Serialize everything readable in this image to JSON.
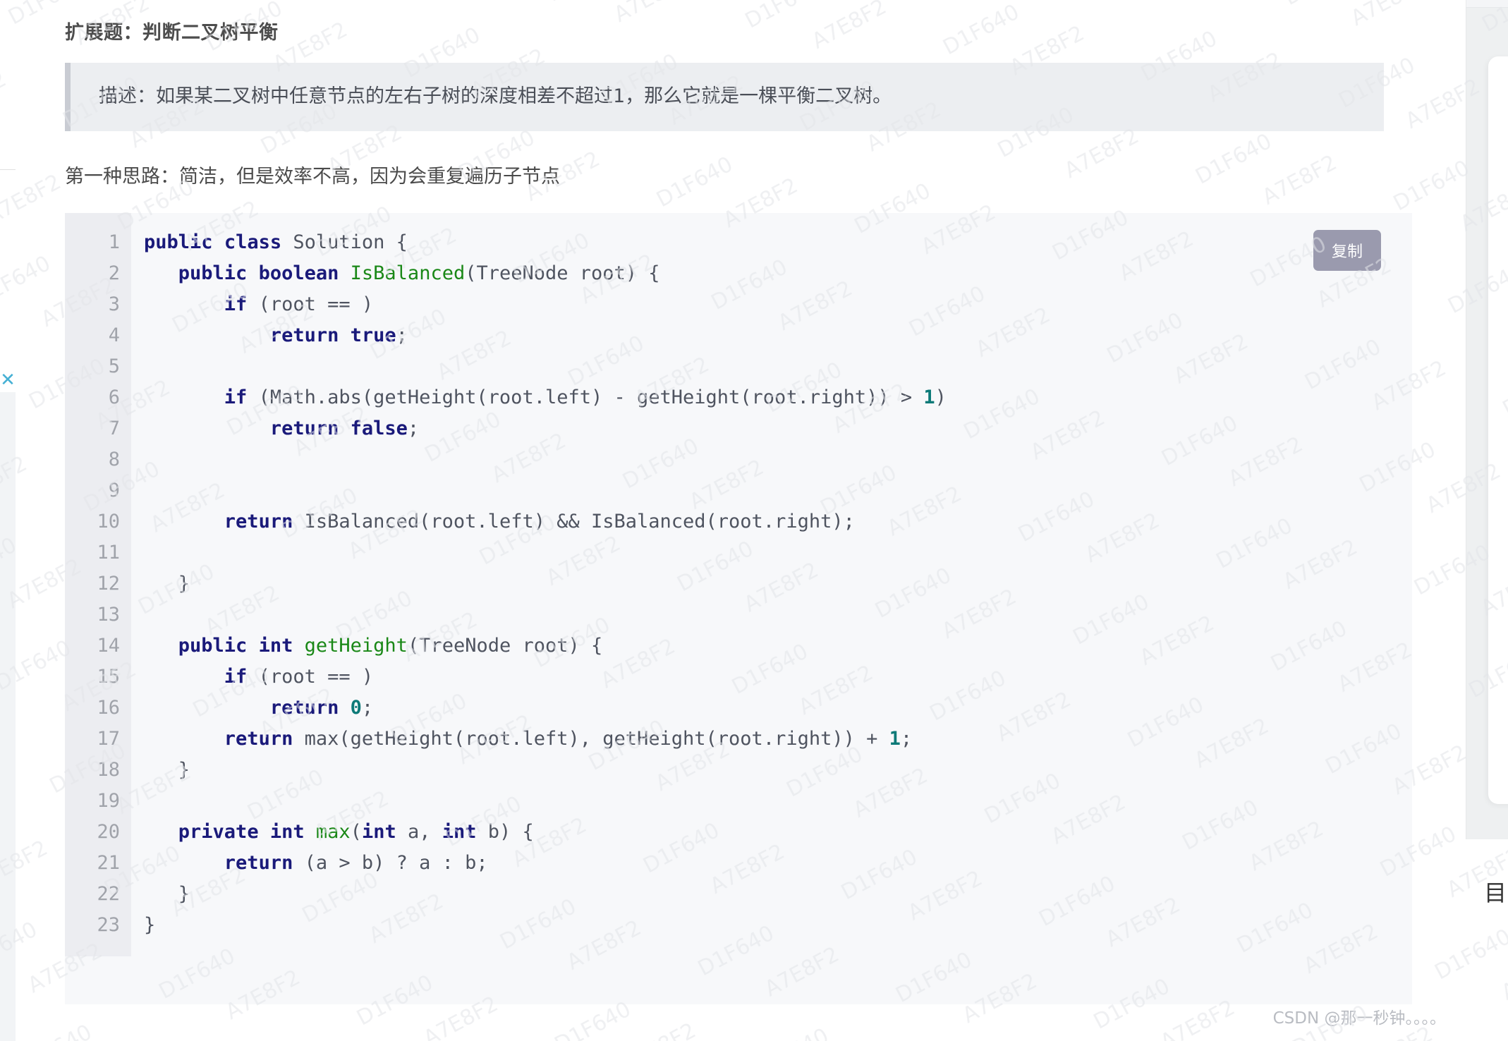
{
  "page": {
    "section_title": "扩展题：判断二叉树平衡",
    "quote_text": "描述：如果某二叉树中任意节点的左右子树的深度相差不超过1，那么它就是一棵平衡二叉树。",
    "approach_text": "第一种思路：简洁，但是效率不高，因为会重复遍历子节点",
    "watermark": "CSDN @那一秒钟。。。。"
  },
  "code_block": {
    "copy_label": "复制",
    "language": "java",
    "line_numbers": [
      "1",
      "2",
      "3",
      "4",
      "5",
      "6",
      "7",
      "8",
      "9",
      "10",
      "11",
      "12",
      "13",
      "14",
      "15",
      "16",
      "17",
      "18",
      "19",
      "20",
      "21",
      "22",
      "23"
    ],
    "lines": [
      "public class Solution {",
      "   public boolean IsBalanced(TreeNode root) {",
      "       if (root == )",
      "           return true;",
      "",
      "       if (Math.abs(getHeight(root.left) - getHeight(root.right)) > 1)",
      "           return false;",
      "",
      "",
      "       return IsBalanced(root.left) && IsBalanced(root.right);",
      "",
      "   }",
      "",
      "   public int getHeight(TreeNode root) {",
      "       if (root == )",
      "           return 0;",
      "       return max(getHeight(root.left), getHeight(root.right)) + 1;",
      "   }",
      "",
      "   private int max(int a, int b) {",
      "       return (a > b) ? a : b;",
      "   }",
      "}"
    ],
    "tokens": [
      [
        [
          "public",
          "kw"
        ],
        [
          " ",
          "pl"
        ],
        [
          "class",
          "kw"
        ],
        [
          " Solution {",
          "pl"
        ]
      ],
      [
        [
          "   ",
          "pl"
        ],
        [
          "public",
          "kw"
        ],
        [
          " ",
          "pl"
        ],
        [
          "boolean",
          "kw"
        ],
        [
          " ",
          "pl"
        ],
        [
          "IsBalanced",
          "fn"
        ],
        [
          "(TreeNode root) {",
          "pl"
        ]
      ],
      [
        [
          "       ",
          "pl"
        ],
        [
          "if",
          "kw"
        ],
        [
          " (root == )",
          "pl"
        ]
      ],
      [
        [
          "           ",
          "pl"
        ],
        [
          "return",
          "kw"
        ],
        [
          " ",
          "pl"
        ],
        [
          "true",
          "kw"
        ],
        [
          ";",
          "pl"
        ]
      ],
      [
        [
          "",
          "pl"
        ]
      ],
      [
        [
          "       ",
          "pl"
        ],
        [
          "if",
          "kw"
        ],
        [
          " (Math.abs(getHeight(root.left) - getHeight(root.right)) > ",
          "pl"
        ],
        [
          "1",
          "num"
        ],
        [
          ")",
          "pl"
        ]
      ],
      [
        [
          "           ",
          "pl"
        ],
        [
          "return",
          "kw"
        ],
        [
          " ",
          "pl"
        ],
        [
          "false",
          "kw"
        ],
        [
          ";",
          "pl"
        ]
      ],
      [
        [
          "",
          "pl"
        ]
      ],
      [
        [
          "",
          "pl"
        ]
      ],
      [
        [
          "       ",
          "pl"
        ],
        [
          "return",
          "kw"
        ],
        [
          " IsBalanced(root.left) && IsBalanced(root.right);",
          "pl"
        ]
      ],
      [
        [
          "",
          "pl"
        ]
      ],
      [
        [
          "   }",
          "pl"
        ]
      ],
      [
        [
          "",
          "pl"
        ]
      ],
      [
        [
          "   ",
          "pl"
        ],
        [
          "public",
          "kw"
        ],
        [
          " ",
          "pl"
        ],
        [
          "int",
          "kw"
        ],
        [
          " ",
          "pl"
        ],
        [
          "getHeight",
          "fn"
        ],
        [
          "(TreeNode root) {",
          "pl"
        ]
      ],
      [
        [
          "       ",
          "pl"
        ],
        [
          "if",
          "kw"
        ],
        [
          " (root == )",
          "pl"
        ]
      ],
      [
        [
          "           ",
          "pl"
        ],
        [
          "return",
          "kw"
        ],
        [
          " ",
          "pl"
        ],
        [
          "0",
          "num"
        ],
        [
          ";",
          "pl"
        ]
      ],
      [
        [
          "       ",
          "pl"
        ],
        [
          "return",
          "kw"
        ],
        [
          " max(getHeight(root.left), getHeight(root.right)) + ",
          "pl"
        ],
        [
          "1",
          "num"
        ],
        [
          ";",
          "pl"
        ]
      ],
      [
        [
          "   }",
          "pl"
        ]
      ],
      [
        [
          "",
          "pl"
        ]
      ],
      [
        [
          "   ",
          "pl"
        ],
        [
          "private",
          "kw"
        ],
        [
          " ",
          "pl"
        ],
        [
          "int",
          "kw"
        ],
        [
          " ",
          "pl"
        ],
        [
          "max",
          "fn"
        ],
        [
          "(",
          "pl"
        ],
        [
          "int",
          "kw"
        ],
        [
          " a, ",
          "pl"
        ],
        [
          "int",
          "kw"
        ],
        [
          " b) {",
          "pl"
        ]
      ],
      [
        [
          "       ",
          "pl"
        ],
        [
          "return",
          "kw"
        ],
        [
          " (a > b) ? a : b;",
          "pl"
        ]
      ],
      [
        [
          "   }",
          "pl"
        ]
      ],
      [
        [
          "}",
          "pl"
        ]
      ]
    ]
  },
  "right_panel": {
    "toc_icon_label": "目"
  },
  "colors": {
    "page_bg": "#f5f6f7",
    "content_bg": "#ffffff",
    "quote_bg": "#eceef1",
    "quote_bar": "#c9ccd3",
    "code_bg": "#f7f8fa",
    "gutter_bg": "#ecedf1",
    "keyword": "#1a1a7a",
    "function": "#1a8817",
    "number": "#0d7a78",
    "plain": "#4f5460",
    "copy_btn_bg": "#9a9aae",
    "close_icon": "#45b0d4"
  }
}
